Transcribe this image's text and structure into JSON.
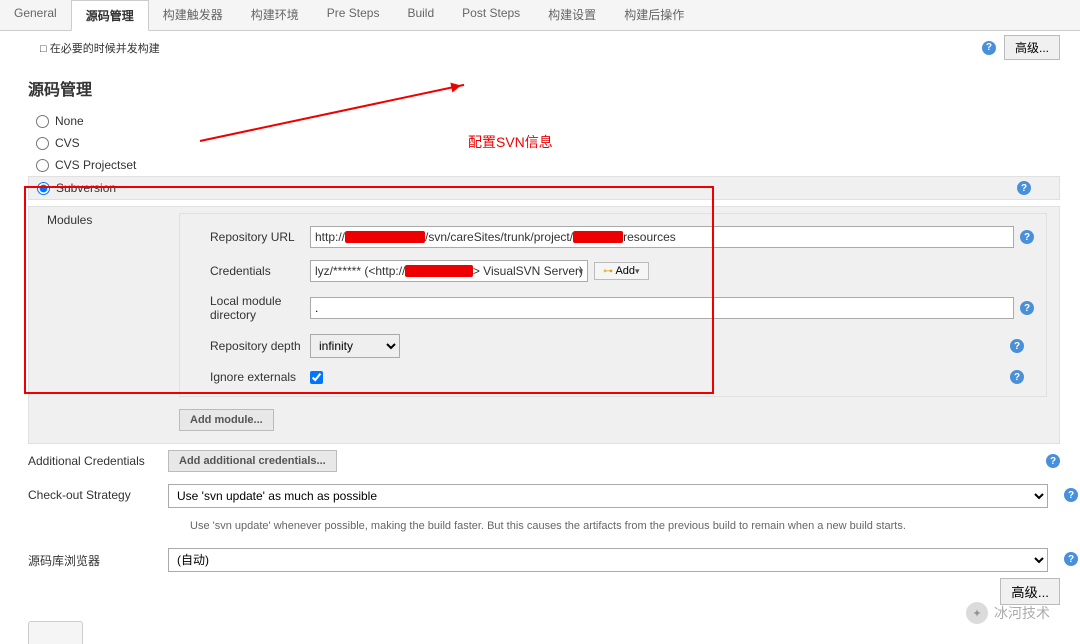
{
  "tabs": [
    "General",
    "源码管理",
    "构建触发器",
    "构建环境",
    "Pre Steps",
    "Build",
    "Post Steps",
    "构建设置",
    "构建后操作"
  ],
  "active_tab_index": 1,
  "topbar": {
    "truncated_text": "□ 在必要的时候并发构建",
    "advanced_btn": "高级..."
  },
  "annotation": {
    "text": "配置SVN信息"
  },
  "section_title": "源码管理",
  "scm_options": [
    {
      "label": "None",
      "selected": false
    },
    {
      "label": "CVS",
      "selected": false
    },
    {
      "label": "CVS Projectset",
      "selected": false
    },
    {
      "label": "Subversion",
      "selected": true
    }
  ],
  "svn": {
    "modules_label": "Modules",
    "fields": {
      "repo_url": {
        "label": "Repository URL",
        "prefix": "http://",
        "mid": "/svn/careSites/trunk/project/",
        "suffix": "resources"
      },
      "credentials": {
        "label": "Credentials",
        "prefix": "lyz/****** (<http://",
        "suffix": "> VisualSVN Server)",
        "add_btn": "Add"
      },
      "local_dir": {
        "label": "Local module directory",
        "value": "."
      },
      "depth": {
        "label": "Repository depth",
        "value": "infinity"
      },
      "ignore_ext": {
        "label": "Ignore externals",
        "checked": true
      }
    },
    "add_module_btn": "Add module..."
  },
  "additional_credentials": {
    "label": "Additional Credentials",
    "btn": "Add additional credentials..."
  },
  "checkout_strategy": {
    "label": "Check-out Strategy",
    "value": "Use 'svn update' as much as possible",
    "desc": "Use 'svn update' whenever possible, making the build faster. But this causes the artifacts from the previous build to remain when a new build starts."
  },
  "repo_browser": {
    "label": "源码库浏览器",
    "value": "(自动)",
    "advanced_btn": "高级..."
  },
  "watermark": "冰河技术"
}
